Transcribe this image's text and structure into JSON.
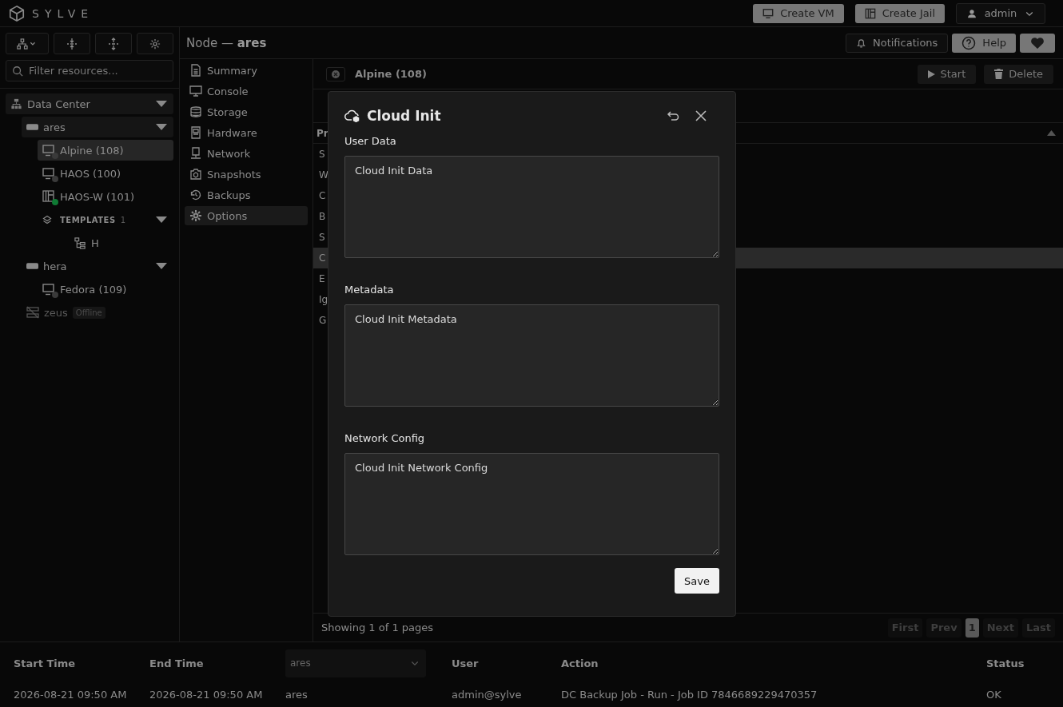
{
  "brand": "SYLVE",
  "top_buttons": [
    {
      "label": "Create VM",
      "kind": "vm"
    },
    {
      "label": "Create Jail",
      "kind": "jail"
    }
  ],
  "user_menu": {
    "label": "admin"
  },
  "sidebar": {
    "tools": [
      {
        "kind": "tree"
      },
      {
        "kind": "expand"
      },
      {
        "kind": "collapse"
      },
      {
        "kind": "settings"
      }
    ],
    "filter": {
      "placeholder": "Filter resources..."
    },
    "tree": [
      {
        "label": "Data Center",
        "kind": "datacenter",
        "selected": false,
        "highlighted": true,
        "expanded": true,
        "children": [
          {
            "label": "ares",
            "kind": "node",
            "selected": false,
            "highlighted": true,
            "expanded": true,
            "children": [
              {
                "label": "Alpine (108)",
                "kind": "vm",
                "selected": true,
                "highlighted": false,
                "color": "#3a3a3a"
              },
              {
                "label": "HAOS (100)",
                "kind": "vm",
                "selected": false,
                "highlighted": false,
                "color": "#3a3a3a"
              },
              {
                "label": "HAOS-W (101)",
                "kind": "jail",
                "selected": false,
                "highlighted": false,
                "color": "#0f7a34"
              },
              {
                "label": "TEMPLATES",
                "count": "1",
                "kind": "group",
                "selected": false,
                "highlighted": false,
                "expanded": true,
                "children": [
                  {
                    "label": "H",
                    "kind": "template",
                    "selected": false,
                    "highlighted": false
                  }
                ]
              }
            ]
          },
          {
            "label": "hera",
            "kind": "node",
            "selected": false,
            "highlighted": false,
            "expanded": true,
            "children": [
              {
                "label": "Fedora (109)",
                "kind": "vm",
                "selected": false,
                "highlighted": false,
                "color": "#3a3a3a"
              }
            ]
          },
          {
            "label": "zeus",
            "kind": "offline",
            "badge": "Offline",
            "selected": false,
            "highlighted": false
          }
        ]
      }
    ]
  },
  "header": {
    "prefix": "Node —",
    "name": "ares"
  },
  "header_buttons": [
    {
      "label": "Notifications",
      "kind": "bell"
    },
    {
      "label": "Help",
      "kind": "help"
    },
    {
      "kind": "heart"
    }
  ],
  "nav": [
    {
      "label": "Summary",
      "kind": "summary",
      "selected": false
    },
    {
      "label": "Console",
      "kind": "console",
      "selected": false
    },
    {
      "label": "Storage",
      "kind": "storage",
      "selected": false
    },
    {
      "label": "Hardware",
      "kind": "hardware",
      "selected": false
    },
    {
      "label": "Network",
      "kind": "network",
      "selected": false
    },
    {
      "label": "Snapshots",
      "kind": "snapshots",
      "selected": false
    },
    {
      "label": "Backups",
      "kind": "backups",
      "selected": false
    },
    {
      "label": "Options",
      "kind": "options",
      "selected": true
    }
  ],
  "vm_tab": {
    "label": "Alpine (108)"
  },
  "vm_actions": [
    {
      "label": "Start",
      "kind": "play"
    },
    {
      "label": "Delete",
      "kind": "trash"
    }
  ],
  "table": {
    "header": "Pr",
    "rows": [
      {
        "cell": "S",
        "selected": false
      },
      {
        "cell": "W",
        "selected": false
      },
      {
        "cell": "C",
        "selected": false
      },
      {
        "cell": "B",
        "selected": false
      },
      {
        "cell": "S",
        "selected": false
      },
      {
        "cell": "C",
        "selected": true
      },
      {
        "cell": "E",
        "selected": false
      },
      {
        "cell": "Ig",
        "selected": false
      },
      {
        "cell": "G",
        "selected": false
      }
    ]
  },
  "pagination": {
    "summary": "Showing 1 of 1 pages",
    "buttons": [
      {
        "label": "First",
        "selected": false
      },
      {
        "label": "Prev",
        "selected": false
      },
      {
        "label": "1",
        "selected": true
      },
      {
        "label": "Next",
        "selected": false
      },
      {
        "label": "Last",
        "selected": false
      }
    ]
  },
  "dialog": {
    "title": "Cloud Init",
    "fields": [
      {
        "label": "User Data",
        "placeholder": "Cloud Init Data"
      },
      {
        "label": "Metadata",
        "placeholder": "Cloud Init Metadata"
      },
      {
        "label": "Network Config",
        "placeholder": "Cloud Init Network Config"
      }
    ],
    "button": "Save"
  },
  "log": {
    "columns": [
      {
        "kind": "text",
        "label": "Start Time"
      },
      {
        "kind": "text",
        "label": "End Time"
      },
      {
        "kind": "select",
        "value": "ares"
      },
      {
        "kind": "text",
        "label": "User"
      },
      {
        "kind": "text",
        "label": "Action"
      },
      {
        "kind": "text",
        "label": "Status"
      }
    ],
    "rows": [
      [
        "2026-08-21 09:50 AM",
        "2026-08-21 09:50 AM",
        "ares",
        "admin@sylve",
        "DC Backup Job - Run - Job ID 7846689229470357",
        "OK"
      ]
    ]
  }
}
